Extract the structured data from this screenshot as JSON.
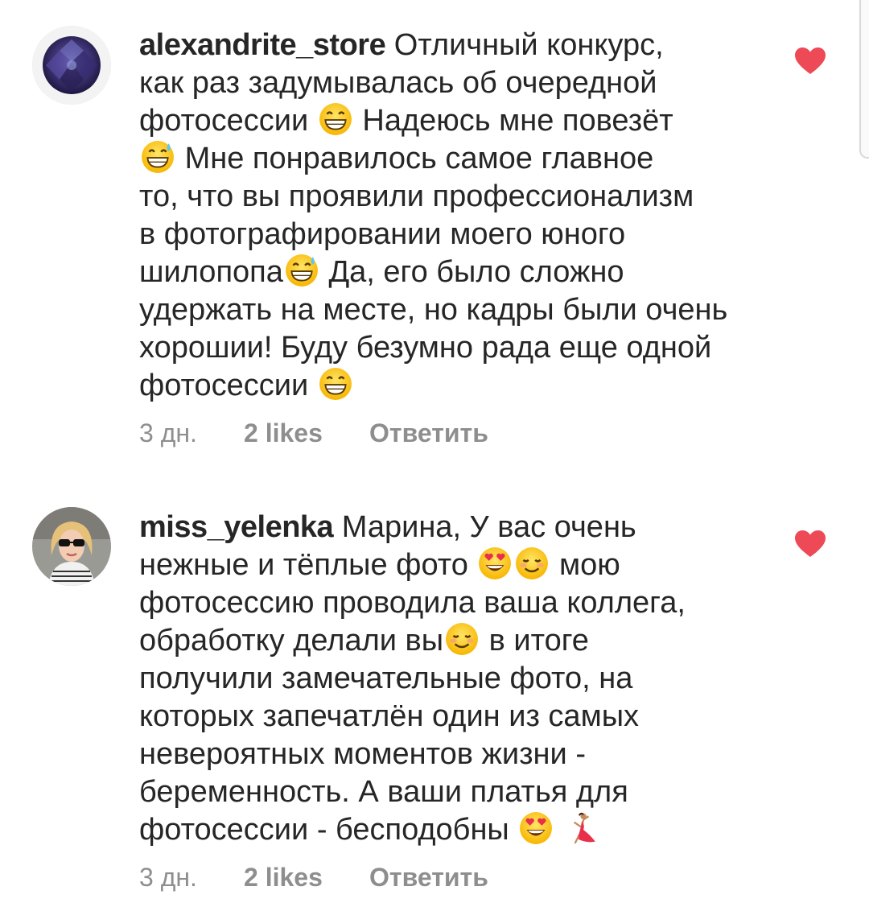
{
  "comments": [
    {
      "username": "alexandrite_store",
      "lines": [
        "Отличный конкурс,",
        "как раз задумывалась об очередной",
        "фотосессии",
        "Надеюсь мне повезёт",
        "Мне понравилось самое главное",
        "то, что вы проявили профессионализм",
        "в фотографировании моего юного",
        "шилопопа",
        "Да, его было сложно",
        "удержать на месте, но кадры были очень",
        "хорошии! Буду безумно рада еще одной",
        "фотосессии"
      ],
      "time": "3 дн.",
      "likes": "2 likes",
      "reply": "Ответить",
      "liked": true,
      "heart_color": "#ed4956",
      "avatar": "purple-gemstone"
    },
    {
      "username": "miss_yelenka",
      "lines": [
        "Марина, У вас очень",
        "нежные и тёплые фото",
        "мою",
        "фотосессию проводила ваша коллега,",
        "обработку делали вы",
        "в итоге",
        "получили замечательные фото, на",
        "которых запечатлён один из самых",
        "невероятных моментов жизни -",
        "беременность. А ваши платья для",
        "фотосессии - бесподобны"
      ],
      "time": "3 дн.",
      "likes": "2 likes",
      "reply": "Ответить",
      "liked": true,
      "heart_color": "#ed4956",
      "avatar": "woman-with-sunglasses"
    }
  ],
  "colors": {
    "text": "#262626",
    "meta": "#8e8e8e",
    "heart": "#ed4956",
    "background": "#ffffff"
  }
}
